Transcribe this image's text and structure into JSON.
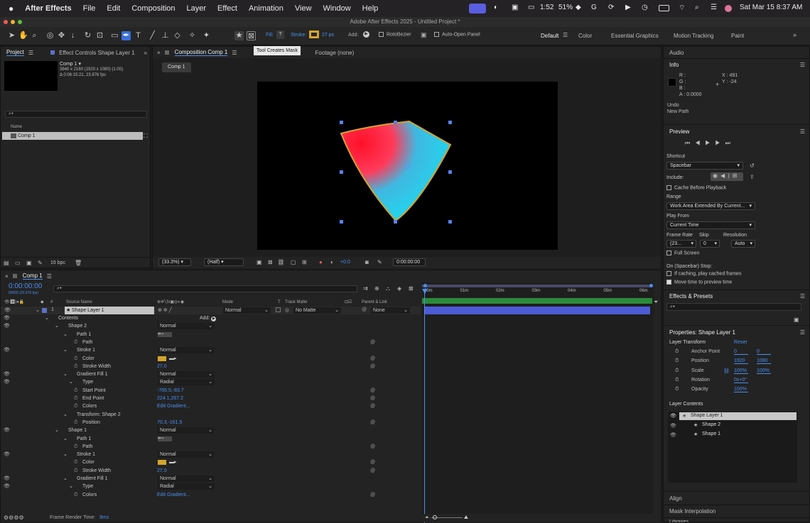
{
  "menubar": {
    "app": "After Effects",
    "items": [
      "File",
      "Edit",
      "Composition",
      "Layer",
      "Effect",
      "Animation",
      "View",
      "Window",
      "Help"
    ],
    "battery": "1:52",
    "battery_pct": "51%",
    "datetime": "Sat Mar 15  8:37 AM"
  },
  "window_title": "Adobe After Effects 2025 - Untitled Project *",
  "toolbar": {
    "fill_label": "Fill:",
    "fill_value": "?",
    "stroke_label": "Stroke:",
    "stroke_width": "27 px",
    "add_label": "Add:",
    "rotobezier": "RotoBezier",
    "auto_open": "Auto-Open Panel",
    "tooltip": "Tool Creates Mask",
    "workspaces": [
      "Default",
      "Color",
      "Essential Graphics",
      "Motion Tracking",
      "Paint"
    ]
  },
  "project": {
    "tab": "Project",
    "effect_tab": "Effect Controls Shape Layer 1",
    "comp_name": "Comp 1 ▾",
    "comp_res": "3840 x 2160  (1920 x 1080) (1.00)",
    "comp_dur": "Δ 0:06:15:21, 23.976 fps",
    "col_name": "Name",
    "item": "Comp 1",
    "bpc": "16 bpc"
  },
  "composition": {
    "tab": "Composition Comp 1",
    "footage": "Footage (none)",
    "comp_button": "Comp 1",
    "zoom": "(33.3%)",
    "resolution": "(Half)",
    "exposure": "+0.0",
    "timecode": "0:00:00:00"
  },
  "timeline": {
    "tab": "Comp 1",
    "timecode": "0:00:00:00",
    "frame_info": "00000 (23.976 fps)",
    "headers": {
      "source": "Source Name",
      "mode": "Mode",
      "t": "T",
      "track_matte": "Track Matte",
      "parent": "Parent & Link"
    },
    "layer": {
      "num": "1",
      "name": "Shape Layer 1",
      "mode": "Normal",
      "matte": "No Matte",
      "parent": "None"
    },
    "add_label": "Add:",
    "ruler": [
      "00m",
      "01m",
      "02m",
      "03m",
      "04m",
      "05m",
      "06m"
    ],
    "render_label": "Frame Render Time:",
    "render_value": "9ms",
    "props": [
      {
        "label": "Contents",
        "indent": 0
      },
      {
        "label": "Shape 2",
        "indent": 1,
        "value": "Normal",
        "dd": true
      },
      {
        "label": "Path 1",
        "indent": 2
      },
      {
        "label": "Path",
        "indent": 3,
        "stop": true
      },
      {
        "label": "Stroke 1",
        "indent": 2,
        "value": "Normal",
        "dd": true
      },
      {
        "label": "Color",
        "indent": 3,
        "stop": true,
        "swatch": true
      },
      {
        "label": "Stroke Width",
        "indent": 3,
        "stop": true,
        "value": "27.0"
      },
      {
        "label": "Gradient Fill 1",
        "indent": 2,
        "value": "Normal",
        "dd": true
      },
      {
        "label": "Type",
        "indent": 3,
        "value": "Radial",
        "dd": true
      },
      {
        "label": "Start Point",
        "indent": 3,
        "stop": true,
        "value": "-765.5,-83.7"
      },
      {
        "label": "End Point",
        "indent": 3,
        "stop": true,
        "value": "224.1,267.2"
      },
      {
        "label": "Colors",
        "indent": 3,
        "stop": true,
        "value": "Edit Gradient..."
      },
      {
        "label": "Transform: Shape 2",
        "indent": 2
      },
      {
        "label": "Position",
        "indent": 3,
        "stop": true,
        "value": "70.3,-161.5"
      },
      {
        "label": "Shape 1",
        "indent": 1,
        "value": "Normal",
        "dd": true
      },
      {
        "label": "Path 1",
        "indent": 2
      },
      {
        "label": "Path",
        "indent": 3,
        "stop": true
      },
      {
        "label": "Stroke 1",
        "indent": 2,
        "value": "Normal",
        "dd": true
      },
      {
        "label": "Color",
        "indent": 3,
        "stop": true,
        "swatch": true
      },
      {
        "label": "Stroke Width",
        "indent": 3,
        "stop": true,
        "value": "27.0"
      },
      {
        "label": "Gradient Fill 1",
        "indent": 2,
        "value": "Normal",
        "dd": true
      },
      {
        "label": "Type",
        "indent": 3,
        "value": "Radial",
        "dd": true
      },
      {
        "label": "Colors",
        "indent": 3,
        "stop": true,
        "value": "Edit Gradient..."
      }
    ]
  },
  "right": {
    "audio": "Audio",
    "info": "Info",
    "info_r": "R :",
    "info_g": "G :",
    "info_b": "B :",
    "info_a": "A : 0.0000",
    "info_x": "X : 491",
    "info_y": "Y : -24",
    "undo": "Undo",
    "new_path": "New Path",
    "preview": "Preview",
    "shortcut": "Shortcut",
    "shortcut_value": "Spacebar",
    "include": "Include:",
    "cache": "Cache Before Playback",
    "range": "Range",
    "range_value": "Work Area Extended By Current...",
    "play_from": "Play From",
    "play_from_value": "Current Time",
    "frame_rate": "Frame Rate",
    "skip": "Skip",
    "resolution": "Resolution",
    "fr_value": "(23...",
    "skip_value": "0",
    "res_value": "Auto",
    "full_screen": "Full Screen",
    "on_stop": "On (Spacebar) Stop:",
    "if_caching": "If caching, play cached frames",
    "move_time": "Move time to preview time",
    "effects": "Effects & Presets",
    "properties": "Properties: Shape Layer 1",
    "layer_transform": "Layer Transform",
    "reset": "Reset",
    "transform": [
      {
        "label": "Anchor Point",
        "v1": "0",
        "v2": "0"
      },
      {
        "label": "Position",
        "v1": "1920",
        "v2": "1080"
      },
      {
        "label": "Scale",
        "v1": "100%",
        "v2": "100%"
      },
      {
        "label": "Rotation",
        "v1": "0x+0°",
        "v2": ""
      },
      {
        "label": "Opacity",
        "v1": "100%",
        "v2": ""
      }
    ],
    "layer_contents": "Layer Contents",
    "contents": [
      "Shape Layer 1",
      "Shape 2",
      "Shape 1"
    ],
    "align": "Align",
    "mask_interp": "Mask Interpolation",
    "libraries": "Libraries"
  },
  "colors": {
    "accent": "#4a8ff0",
    "stroke": "#d4a52c",
    "layer_bar": "#4d5bd6"
  }
}
